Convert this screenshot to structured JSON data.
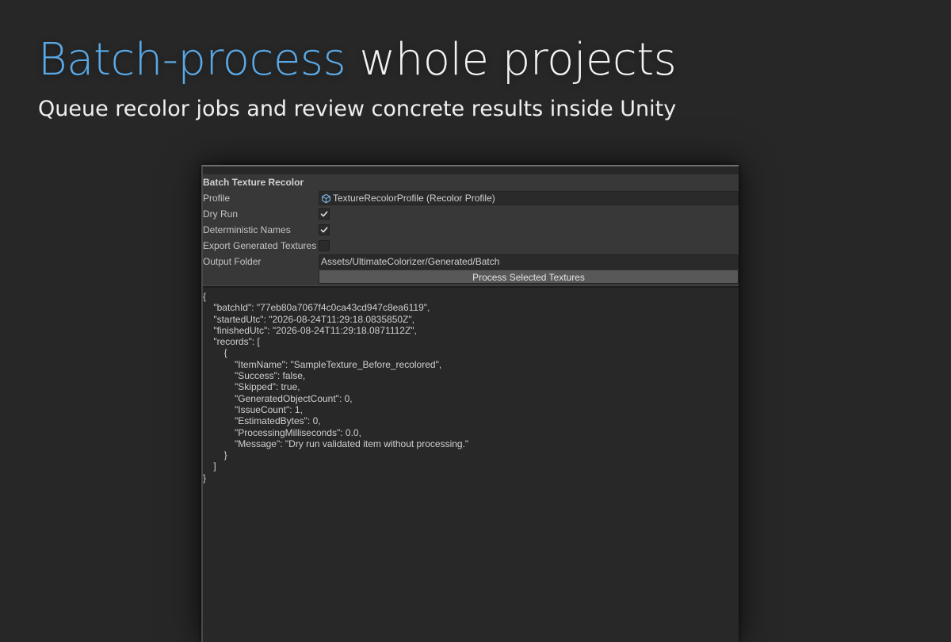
{
  "hero": {
    "title_accent": "Batch-process",
    "title_rest": " whole projects",
    "subtitle": "Queue recolor jobs and review concrete results inside Unity"
  },
  "colors": {
    "accent": "#5aa9e6",
    "background": "#272727",
    "panel": "#383838"
  },
  "window": {
    "section_title": "Batch Texture Recolor",
    "fields": {
      "profile": {
        "label": "Profile",
        "value": "TextureRecolorProfile (Recolor Profile)",
        "icon": "scriptable-object-icon"
      },
      "dry_run": {
        "label": "Dry Run",
        "checked": true
      },
      "deterministic_names": {
        "label": "Deterministic Names",
        "checked": true
      },
      "export_generated_textures": {
        "label": "Export Generated Textures",
        "checked": false
      },
      "output_folder": {
        "label": "Output Folder",
        "value": "Assets/UltimateColorizer/Generated/Batch"
      }
    },
    "process_button": "Process Selected Textures",
    "output_lines": [
      "{",
      "    \"batchId\": \"77eb80a7067f4c0ca43cd947c8ea6119\",",
      "    \"startedUtc\": \"2026-08-24T11:29:18.0835850Z\",",
      "    \"finishedUtc\": \"2026-08-24T11:29:18.0871112Z\",",
      "    \"records\": [",
      "        {",
      "            \"ItemName\": \"SampleTexture_Before_recolored\",",
      "            \"Success\": false,",
      "            \"Skipped\": true,",
      "            \"GeneratedObjectCount\": 0,",
      "            \"IssueCount\": 1,",
      "            \"EstimatedBytes\": 0,",
      "            \"ProcessingMilliseconds\": 0.0,",
      "            \"Message\": \"Dry run validated item without processing.\"",
      "        }",
      "    ]",
      "}"
    ]
  }
}
